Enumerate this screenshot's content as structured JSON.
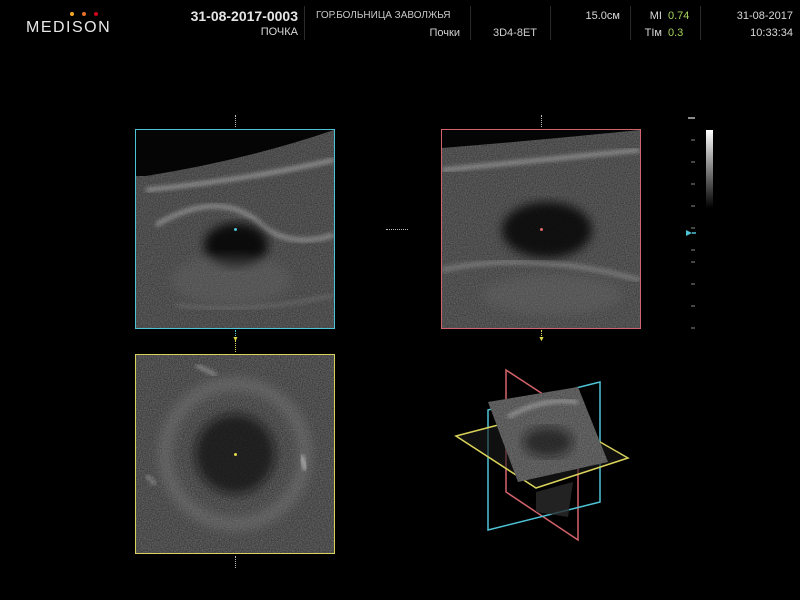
{
  "header": {
    "logo_text": "MEDISON",
    "logo_dot_colors": [
      "#f5a623",
      "#e8702a",
      "#d0021b"
    ],
    "patient_id": "31-08-2017-0003",
    "organ": "ПОЧКА",
    "hospital": "ГОР.БОЛЬНИЦА ЗАВОЛЖЬЯ",
    "preset": "Почки",
    "probe": "3D4-8ET",
    "depth": "15.0см",
    "mi_label": "MI",
    "mi_value": "0.74",
    "ti_label": "TIм",
    "ti_value": "0.3",
    "date": "31-08-2017",
    "time": "10:33:34"
  },
  "panes": {
    "a": {
      "border_color": "#4fc3d6",
      "marker_color": "#4fc3d6",
      "plane": "A"
    },
    "b": {
      "border_color": "#d4626a",
      "marker_color": "#e06a6a",
      "plane": "B"
    },
    "c": {
      "border_color": "#d8d25a",
      "marker_color": "#e0d84a",
      "plane": "C"
    }
  },
  "icons": [
    "medison-logo-icon",
    "grayscale-bar-icon",
    "depth-scale-icon",
    "focus-marker-icon",
    "3d-render-icon"
  ]
}
